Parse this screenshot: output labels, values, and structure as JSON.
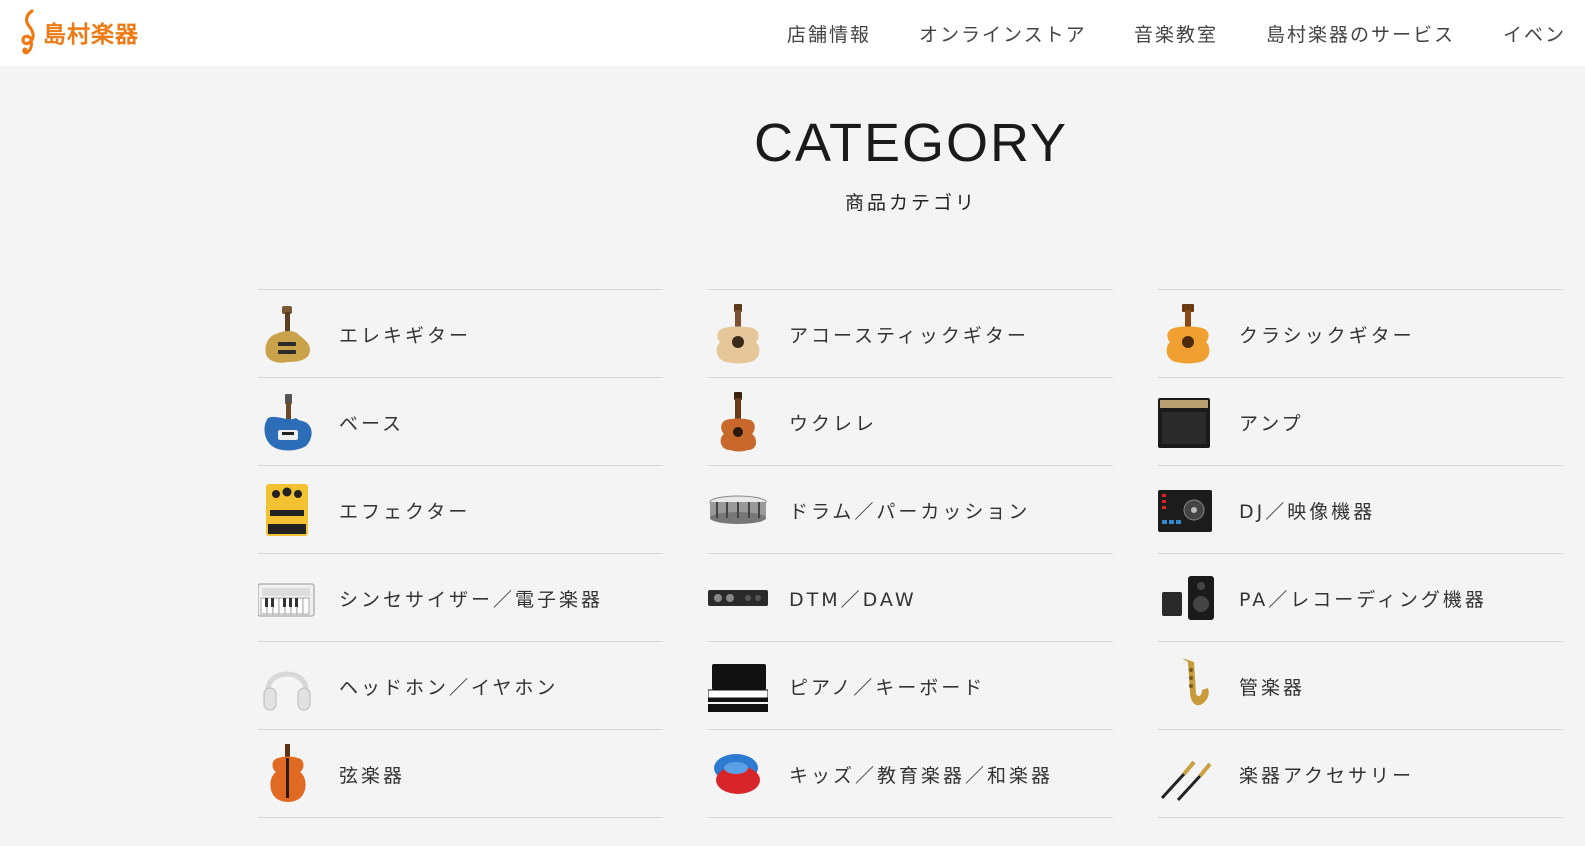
{
  "brand": {
    "name": "島村楽器",
    "color": "#ee7a14"
  },
  "nav": [
    {
      "label": "店舗情報"
    },
    {
      "label": "オンラインストア"
    },
    {
      "label": "音楽教室"
    },
    {
      "label": "島村楽器のサービス"
    },
    {
      "label": "イベン"
    }
  ],
  "section": {
    "title": "CATEGORY",
    "subtitle": "商品カテゴリ"
  },
  "categories": [
    [
      {
        "label": "エレキギター",
        "icon": "electric-guitar-icon"
      },
      {
        "label": "ベース",
        "icon": "bass-guitar-icon"
      },
      {
        "label": "エフェクター",
        "icon": "effects-pedal-icon"
      },
      {
        "label": "シンセサイザー／電子楽器",
        "icon": "synthesizer-icon"
      },
      {
        "label": "ヘッドホン／イヤホン",
        "icon": "headphones-icon"
      },
      {
        "label": "弦楽器",
        "icon": "violin-icon"
      }
    ],
    [
      {
        "label": "アコースティックギター",
        "icon": "acoustic-guitar-icon"
      },
      {
        "label": "ウクレレ",
        "icon": "ukulele-icon"
      },
      {
        "label": "ドラム／パーカッション",
        "icon": "snare-drum-icon"
      },
      {
        "label": "DTM／DAW",
        "icon": "audio-interface-icon"
      },
      {
        "label": "ピアノ／キーボード",
        "icon": "piano-icon"
      },
      {
        "label": "キッズ／教育楽器／和楽器",
        "icon": "castanets-icon"
      }
    ],
    [
      {
        "label": "クラシックギター",
        "icon": "classical-guitar-icon"
      },
      {
        "label": "アンプ",
        "icon": "amplifier-icon"
      },
      {
        "label": "DJ／映像機器",
        "icon": "dj-controller-icon"
      },
      {
        "label": "PA／レコーディング機器",
        "icon": "pa-speaker-icon"
      },
      {
        "label": "管楽器",
        "icon": "saxophone-icon"
      },
      {
        "label": "楽器アクセサリー",
        "icon": "cable-icon"
      }
    ]
  ]
}
